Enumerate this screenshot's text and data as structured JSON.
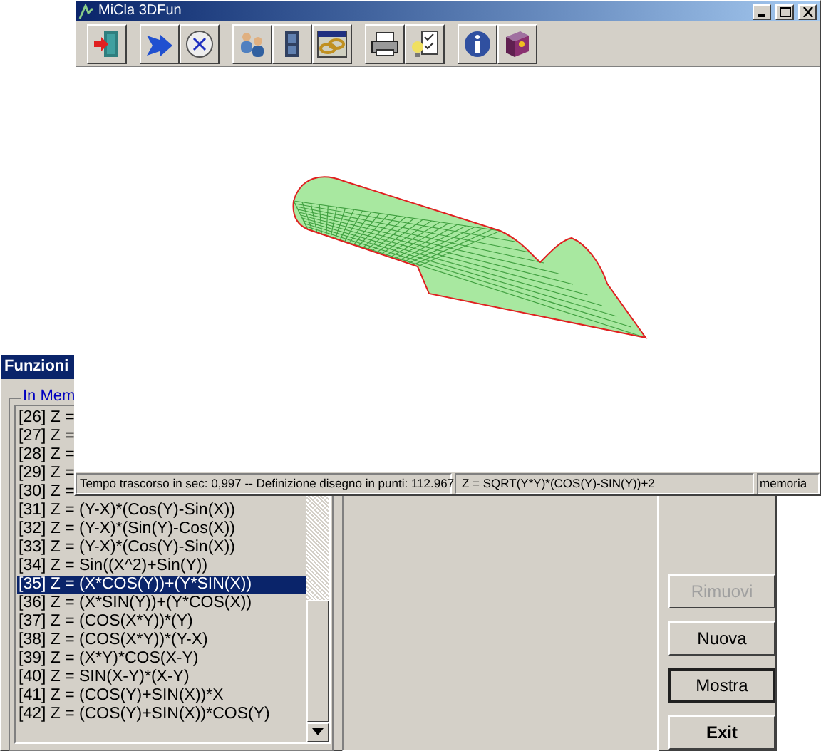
{
  "main_window": {
    "title": "MiCla 3DFun",
    "status_bar": [
      "Tempo trascorso in sec: 0,997 -- Definizione disegno in punti: 112.967",
      "Z = SQRT(Y*Y)*(COS(Y)-SIN(Y))+2",
      "memoria"
    ]
  },
  "functions_window": {
    "title": "Funzioni",
    "group_label": "In Mem",
    "items": [
      {
        "text": "[26] Z =",
        "selected": false
      },
      {
        "text": "[27] Z =",
        "selected": false
      },
      {
        "text": "[28] Z =",
        "selected": false
      },
      {
        "text": "[29] Z =",
        "selected": false
      },
      {
        "text": "[30] Z =",
        "selected": false
      },
      {
        "text": "[31] Z = (Y-X)*(Cos(Y)-Sin(X))",
        "selected": false
      },
      {
        "text": "[32] Z = (Y-X)*(Sin(Y)-Cos(X))",
        "selected": false
      },
      {
        "text": "[33] Z = (Y-X)*(Cos(Y)-Sin(X))",
        "selected": false
      },
      {
        "text": "[34] Z = Sin((X^2)+Sin(Y))",
        "selected": false
      },
      {
        "text": "[35] Z = (X*COS(Y))+(Y*SIN(X))",
        "selected": true
      },
      {
        "text": "[36] Z = (X*SIN(Y))+(Y*COS(X))",
        "selected": false
      },
      {
        "text": "[37] Z = (COS(X*Y))*(Y)",
        "selected": false
      },
      {
        "text": "[38] Z = (COS(X*Y))*(Y-X)",
        "selected": false
      },
      {
        "text": "[39] Z = (X*Y)*COS(X-Y)",
        "selected": false
      },
      {
        "text": "[40] Z = SIN(X-Y)*(X-Y)",
        "selected": false
      },
      {
        "text": "[41] Z = (COS(Y)+SIN(X))*X",
        "selected": false
      },
      {
        "text": "[42] Z = (COS(Y)+SIN(X))*COS(Y)",
        "selected": false
      }
    ],
    "buttons": [
      {
        "label": "Rimuovi",
        "disabled": true,
        "default": false,
        "bold": false
      },
      {
        "label": "Nuova",
        "disabled": false,
        "default": false,
        "bold": false
      },
      {
        "label": "Mostra",
        "disabled": false,
        "default": true,
        "bold": false
      },
      {
        "label": "Exit",
        "disabled": false,
        "default": false,
        "bold": true
      }
    ]
  }
}
